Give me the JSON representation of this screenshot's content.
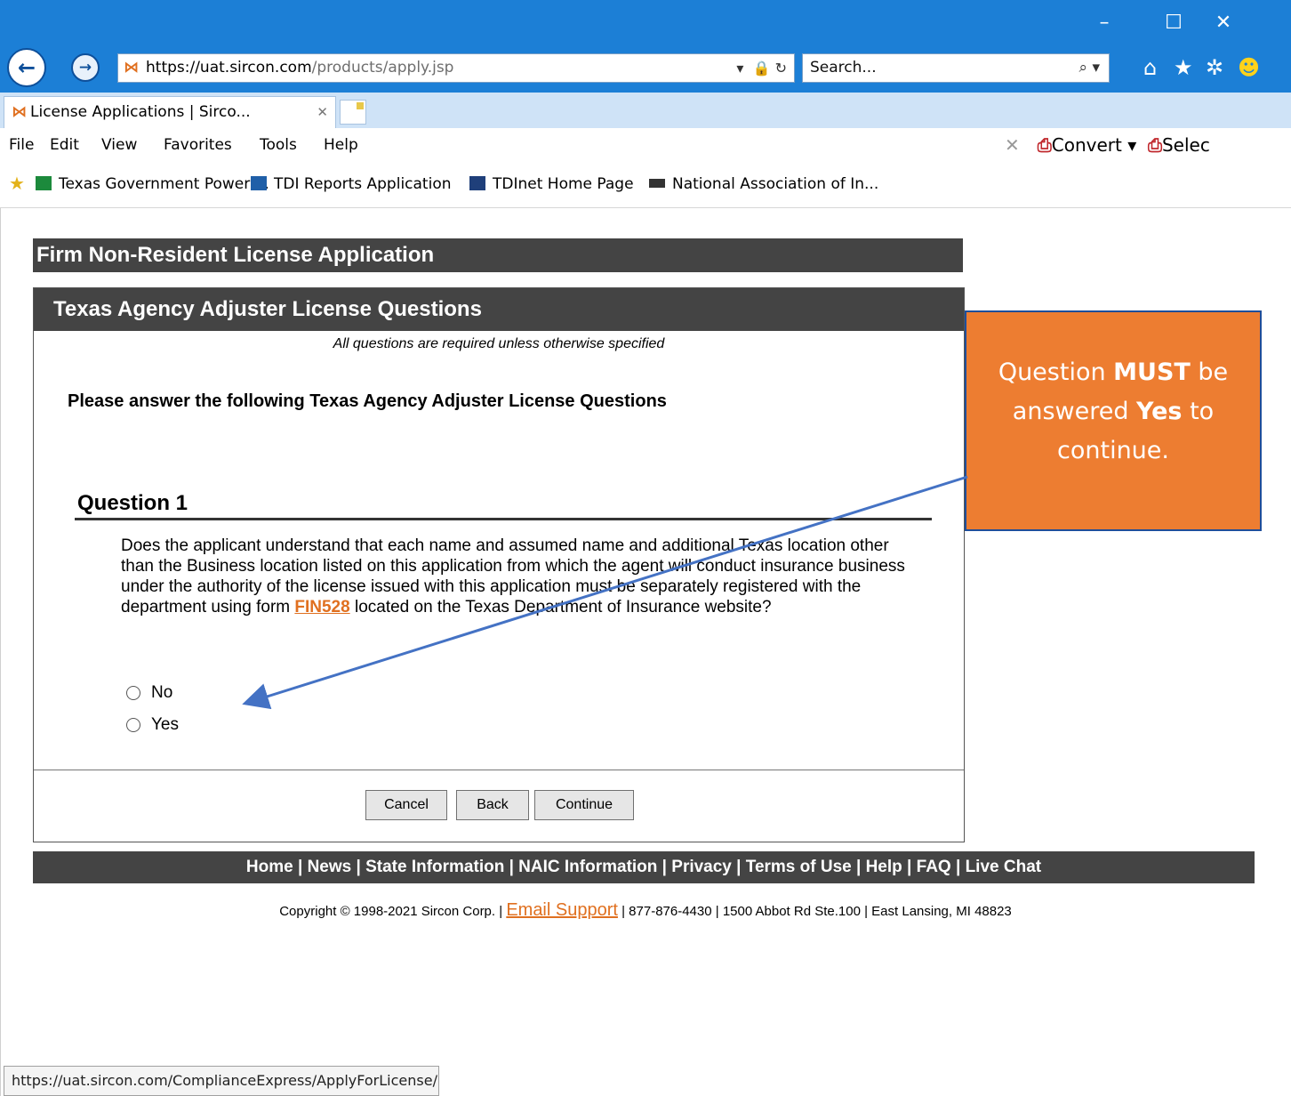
{
  "browser": {
    "url_domain": "https://uat.sircon.com",
    "url_path": "/products/apply.jsp",
    "search_placeholder": "Search...",
    "tab_title": "License Applications | Sirco...",
    "menu": [
      "File",
      "Edit",
      "View",
      "Favorites",
      "Tools",
      "Help"
    ],
    "convert_label": "Convert",
    "select_label": "Selec",
    "favorites": [
      "Texas Government Power ...",
      "TDI Reports Application",
      "TDInet Home Page",
      "National Association of In..."
    ],
    "status_url": "https://uat.sircon.com/ComplianceExpress/ApplyForLicense/"
  },
  "page": {
    "app_title": "Firm Non-Resident License Application",
    "section_title": "Texas Agency Adjuster License Questions",
    "required_note": "All questions are required unless otherwise specified",
    "instruction": "Please answer the following Texas Agency Adjuster License Questions",
    "question_heading": "Question 1",
    "question_text_before": "Does the applicant understand that each name and assumed name and additional Texas location other than the Business location listed on this application from which the agent will conduct insurance business under the authority of the license issued with this application must be separately registered with the department using form ",
    "question_link": "FIN528",
    "question_text_after": " located on the Texas Department of Insurance website?",
    "options": [
      "No",
      "Yes"
    ],
    "buttons": {
      "cancel": "Cancel",
      "back": "Back",
      "continue": "Continue"
    },
    "footer_links": "Home | News | State Information | NAIC Information | Privacy | Terms of Use | Help | FAQ | Live Chat",
    "copyright_before": "Copyright © 1998-2021 Sircon Corp. | ",
    "email_support": "Email Support",
    "copyright_after": " | 877-876-4430 | 1500 Abbot Rd Ste.100 | East Lansing, MI 48823"
  },
  "annotation": {
    "line1_a": "Question ",
    "line1_b": "MUST",
    "line1_c": " be",
    "line2_a": "answered ",
    "line2_b": "Yes",
    "line2_c": " to",
    "line3": "continue.",
    "fill_color": "#ed7d31",
    "arrow_color": "#4472c4"
  }
}
